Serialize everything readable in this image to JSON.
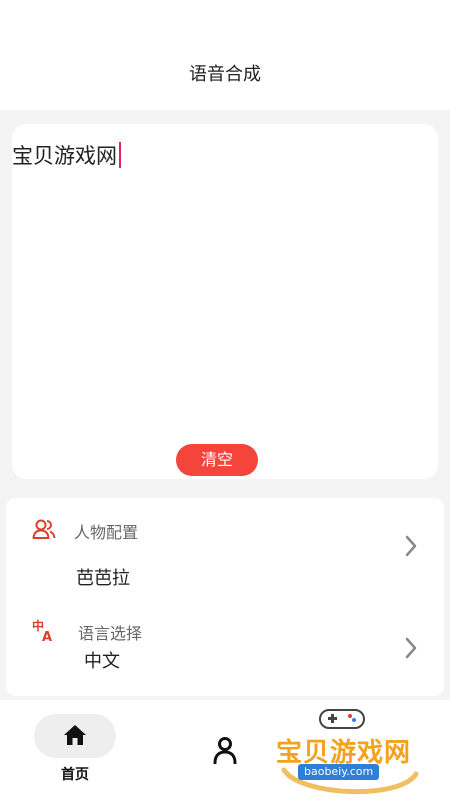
{
  "header": {
    "title": "语音合成"
  },
  "editor": {
    "text": "宝贝游戏网",
    "clear_label": "清空"
  },
  "settings": {
    "character": {
      "label": "人物配置",
      "value": "芭芭拉",
      "icon": "users-icon"
    },
    "language": {
      "label": "语言选择",
      "value": "中文",
      "icon": "translate-icon"
    }
  },
  "nav": {
    "home_label": "首页",
    "home_icon": "home-icon",
    "profile_icon": "person-icon"
  },
  "watermark": {
    "text": "宝贝游戏网",
    "url": "baobeiy.com"
  },
  "colors": {
    "accent": "#f4443c",
    "caret": "#e0245e",
    "icon_red": "#d9402c"
  }
}
